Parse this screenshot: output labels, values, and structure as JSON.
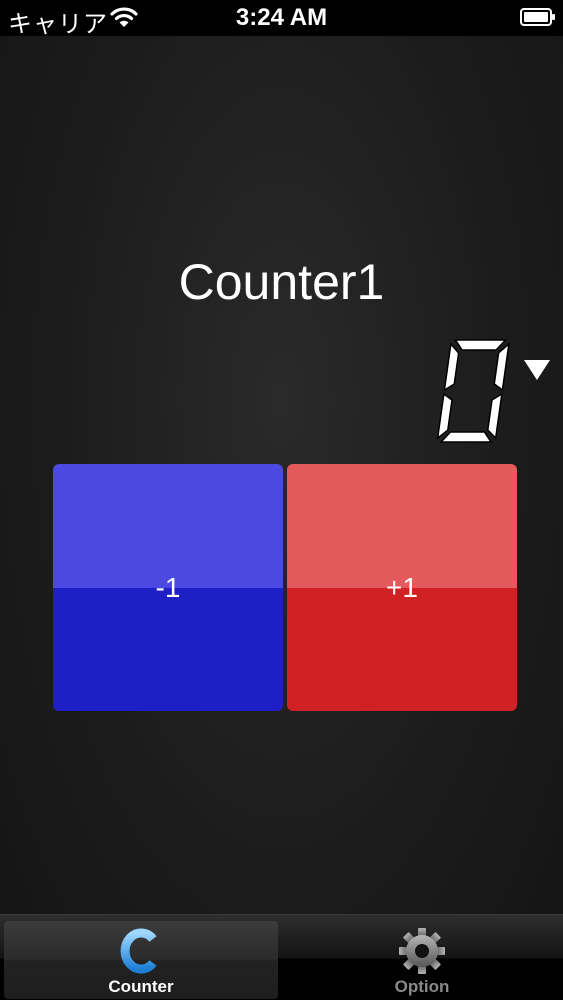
{
  "status_bar": {
    "carrier": "キャリア",
    "time": "3:24 AM",
    "wifi_icon": "wifi-icon",
    "battery_icon": "battery-icon"
  },
  "counter": {
    "title": "Counter1",
    "value": "0",
    "dropdown_icon": "triangle-down-icon"
  },
  "buttons": {
    "minus_label": "-1",
    "plus_label": "+1",
    "minus_colors": [
      "#4a4ae0",
      "#1f1fc6"
    ],
    "plus_colors": [
      "#e45a5c",
      "#d02224"
    ]
  },
  "tab_bar": {
    "tabs": [
      {
        "label": "Counter",
        "icon": "letter-c-icon",
        "selected": true
      },
      {
        "label": "Option",
        "icon": "gear-icon",
        "selected": false
      }
    ]
  }
}
